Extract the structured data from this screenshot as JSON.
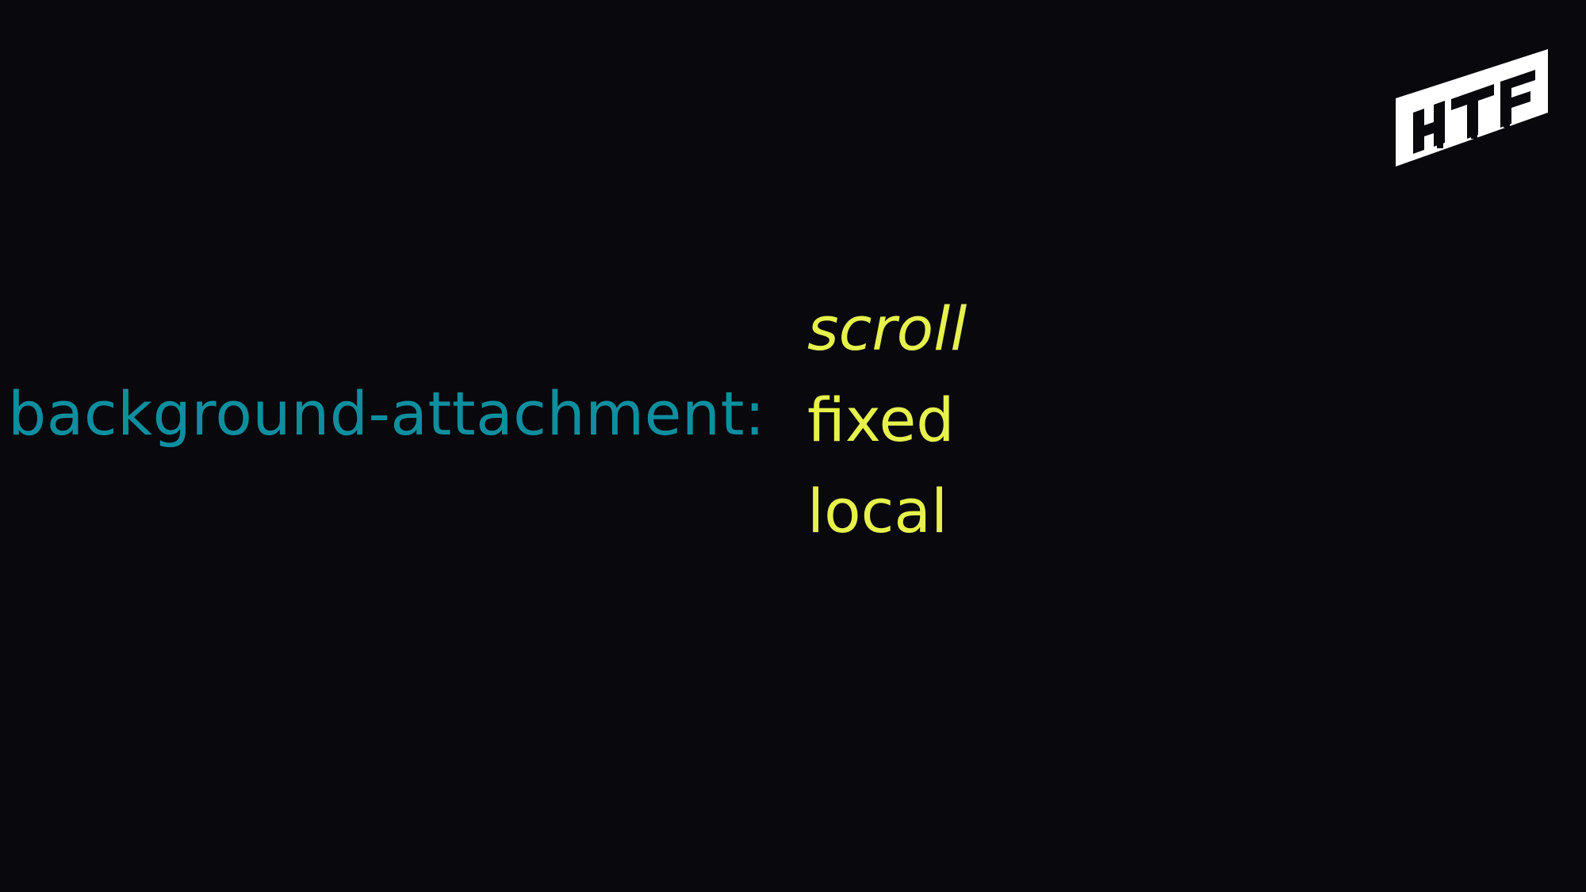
{
  "slide": {
    "property": "background-attachment:",
    "values": [
      {
        "label": "scroll",
        "style": "italic"
      },
      {
        "label": "fixed",
        "style": "normal"
      },
      {
        "label": "local",
        "style": "normal"
      }
    ]
  },
  "logo": {
    "text": "HTF",
    "icon": "htf-logo-icon"
  },
  "colors": {
    "background": "#09080d",
    "property": "#0e8fa0",
    "value": "#e6f24b",
    "logo": "#ffffff"
  }
}
